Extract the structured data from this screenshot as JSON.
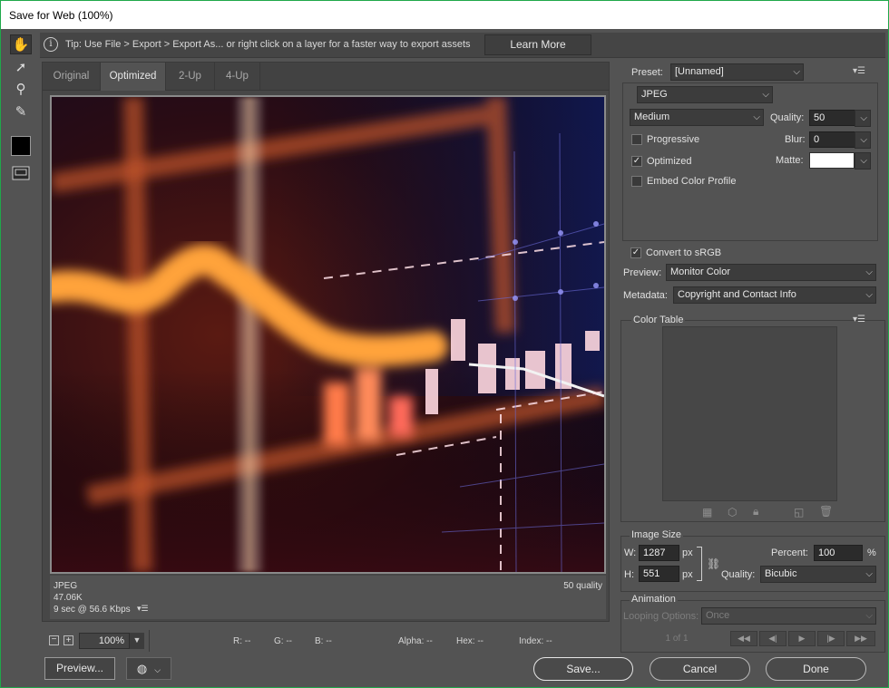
{
  "window": {
    "title": "Save for Web (100%)"
  },
  "tools": [
    {
      "name": "hand-tool-icon",
      "glyph": "✋",
      "active": true
    },
    {
      "name": "slice-select-tool-icon",
      "glyph": "➚",
      "active": false
    },
    {
      "name": "zoom-tool-icon",
      "glyph": "⚲",
      "active": false
    },
    {
      "name": "eyedropper-tool-icon",
      "glyph": "✎",
      "active": false
    },
    {
      "name": "eyedropper-color-swatch",
      "glyph": "",
      "active": false
    },
    {
      "name": "toggle-slices-icon",
      "glyph": "▭",
      "active": false
    }
  ],
  "tip": {
    "text": "Tip: Use File > Export > Export As...  or right click on a layer for a faster way to export assets",
    "learn_more": "Learn More"
  },
  "tabs": [
    "Original",
    "Optimized",
    "2-Up",
    "4-Up"
  ],
  "active_tab": "Optimized",
  "image_info": {
    "format": "JPEG",
    "size": "47.06K",
    "time": "9 sec @ 56.6 Kbps",
    "quality": "50 quality"
  },
  "status": {
    "zoom": "100%",
    "r": "R: --",
    "g": "G: --",
    "b": "B: --",
    "alpha": "Alpha: --",
    "hex": "Hex: --",
    "index": "Index: --"
  },
  "settings": {
    "preset_label": "Preset:",
    "preset_value": "[Unnamed]",
    "format": "JPEG",
    "quality_level": "Medium",
    "quality_label": "Quality:",
    "quality_value": "50",
    "blur_label": "Blur:",
    "blur_value": "0",
    "matte_label": "Matte:",
    "progressive": {
      "label": "Progressive",
      "checked": false
    },
    "optimized": {
      "label": "Optimized",
      "checked": true
    },
    "embed_profile": {
      "label": "Embed Color Profile",
      "checked": false
    },
    "convert_srgb": {
      "label": "Convert to sRGB",
      "checked": true
    },
    "preview_label": "Preview:",
    "preview_value": "Monitor Color",
    "metadata_label": "Metadata:",
    "metadata_value": "Copyright and Contact Info"
  },
  "color_table": {
    "title": "Color Table"
  },
  "image_size": {
    "title": "Image Size",
    "w_label": "W:",
    "w_value": "1287",
    "h_label": "H:",
    "h_value": "551",
    "unit": "px",
    "percent_label": "Percent:",
    "percent_value": "100",
    "percent_unit": "%",
    "quality_label": "Quality:",
    "quality_value": "Bicubic"
  },
  "animation": {
    "title": "Animation",
    "looping_label": "Looping Options:",
    "looping_value": "Once",
    "frame": "1 of 1"
  },
  "buttons": {
    "preview": "Preview...",
    "save": "Save...",
    "cancel": "Cancel",
    "done": "Done"
  },
  "colors": {
    "panel": "#535353",
    "accent_border": "#1fa84a",
    "matte": "#ffffff"
  }
}
